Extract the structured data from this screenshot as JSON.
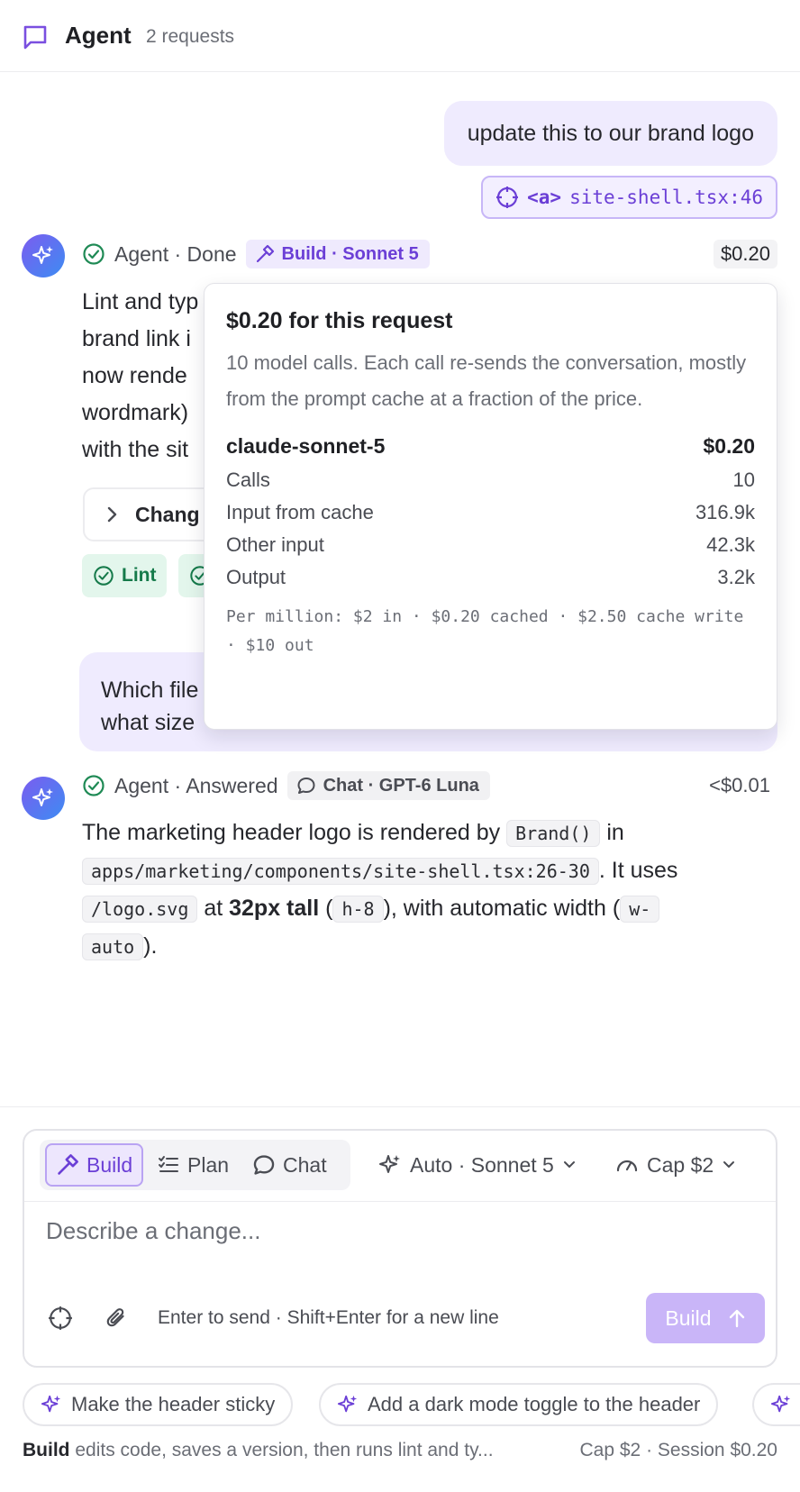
{
  "header": {
    "title": "Agent",
    "count": "2 requests"
  },
  "thread": {
    "user_msg_1": "update this to our brand logo",
    "element_ref": {
      "tag": "<a>",
      "file": "site-shell.tsx:46"
    },
    "agent_1": {
      "label": "Agent · Done",
      "mode": "Build · Sonnet 5",
      "cost": "$0.20",
      "text_lines": [
        "Lint and typ",
        "brand link i",
        "now rende",
        "wordmark)",
        "with the sit"
      ],
      "changed_label": "Chang",
      "check_lint": "Lint"
    },
    "user_msg_2_lines": [
      "Which file",
      "what size"
    ],
    "agent_2": {
      "label": "Agent · Answered",
      "mode": "Chat · GPT-6 Luna",
      "cost": "<$0.01",
      "t1": "The marketing header logo is rendered by ",
      "c1": "Brand()",
      "t2": " in",
      "c2": "apps/marketing/components/site-shell.tsx:26-30",
      "t3": ". It uses",
      "c3": "/logo.svg",
      "t4": " at ",
      "b1": "32px tall",
      "t5": " (",
      "c4": "h-8",
      "t6": "), with automatic width (",
      "c5a": "w-",
      "c5b": "auto",
      "t7": ")."
    }
  },
  "popover": {
    "title": "$0.20 for this request",
    "description": "10 model calls. Each call re-sends the conversation, mostly from the prompt cache at a fraction of the price.",
    "model": "claude-sonnet-5",
    "model_cost": "$0.20",
    "rows": [
      {
        "label": "Calls",
        "value": "10"
      },
      {
        "label": "Input from cache",
        "value": "316.9k"
      },
      {
        "label": "Other input",
        "value": "42.3k"
      },
      {
        "label": "Output",
        "value": "3.2k"
      }
    ],
    "pricing_note": "Per million: $2 in · $0.20 cached · $2.50 cache write · $10 out"
  },
  "composer": {
    "modes": {
      "build": "Build",
      "plan": "Plan",
      "chat": "Chat"
    },
    "model_selector": "Auto · Sonnet 5",
    "cap_selector": "Cap $2",
    "placeholder": "Describe a change...",
    "hint": "Enter to send · Shift+Enter for a new line",
    "send_label": "Build"
  },
  "suggestions": [
    "Make the header sticky",
    "Add a dark mode toggle to the header"
  ],
  "footer": {
    "mode_name": "Build",
    "mode_desc": " edits code, saves a version, then runs lint and ty...",
    "right": "Cap $2 · Session $0.20"
  },
  "colors": {
    "accent": "#6b3fd6",
    "accent_bg": "#efebfe",
    "success": "#157a4a"
  },
  "icons": [
    "chat-bubble-icon",
    "crosshair-icon",
    "sparkle-icon",
    "check-circle-icon",
    "hammer-icon",
    "chevron-right-icon",
    "list-icon",
    "gauge-icon",
    "chevron-down-icon",
    "paperclip-icon",
    "arrow-up-icon"
  ]
}
